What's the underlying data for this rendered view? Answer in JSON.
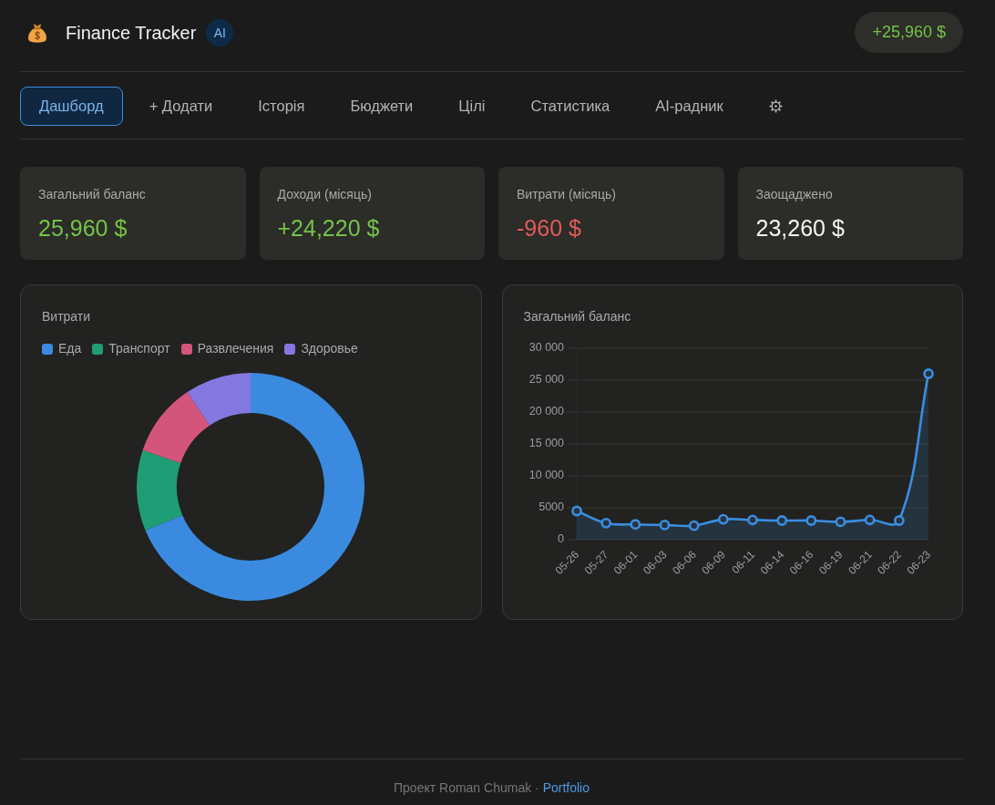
{
  "header": {
    "title": "Finance Tracker",
    "badge": "AI",
    "balance": "+25,960 $"
  },
  "nav": {
    "tabs": [
      {
        "kind": "text",
        "label": "Дашборд",
        "selected": true
      },
      {
        "kind": "text",
        "label": "+ Додати",
        "selected": false
      },
      {
        "kind": "text",
        "label": "Історія",
        "selected": false
      },
      {
        "kind": "text",
        "label": "Бюджети",
        "selected": false
      },
      {
        "kind": "text",
        "label": "Цілі",
        "selected": false
      },
      {
        "kind": "text",
        "label": "Статистика",
        "selected": false
      },
      {
        "kind": "text",
        "label": "AI-радник",
        "selected": false
      },
      {
        "kind": "settings",
        "selected": false
      }
    ]
  },
  "stats": [
    {
      "label": "Загальний баланс",
      "value": "25,960 $",
      "color": "#74c447"
    },
    {
      "label": "Доходи (місяць)",
      "value": "+24,220 $",
      "color": "#74c447"
    },
    {
      "label": "Витрати (місяць)",
      "value": "-960 $",
      "color": "#e05a5a"
    },
    {
      "label": "Заощаджено",
      "value": "23,260 $",
      "color": "#f4f4f4"
    }
  ],
  "expenses_chart": {
    "title": "Витрати",
    "legend": [
      {
        "label": "Еда",
        "color": "#3a8be0"
      },
      {
        "label": "Транспорт",
        "color": "#1f9e75"
      },
      {
        "label": "Развлечения",
        "color": "#d4557c"
      },
      {
        "label": "Здоровье",
        "color": "#8478e0"
      }
    ]
  },
  "balance_chart": {
    "chart_data": {
      "type": "area",
      "title": "Загальний баланс",
      "categories": [
        "05-26",
        "05-27",
        "06-01",
        "06-03",
        "06-06",
        "06-09",
        "06-11",
        "06-14",
        "06-16",
        "06-19",
        "06-21",
        "06-22",
        "06-23"
      ],
      "values": [
        4500,
        2600,
        2400,
        2300,
        2200,
        3200,
        3100,
        3000,
        3000,
        2800,
        3100,
        3000,
        26000
      ],
      "ylim": [
        0,
        30000
      ],
      "yticks": [
        0,
        5000,
        {
          "value": 10000,
          "label": "10 000"
        },
        {
          "value": 15000,
          "label": "15 000"
        },
        {
          "value": 20000,
          "label": "20 000"
        },
        {
          "value": 25000,
          "label": "25 000"
        },
        {
          "value": 30000,
          "label": "30 000"
        }
      ],
      "grid": true
    }
  },
  "footer": {
    "text": "Проект Roman Chumak ·",
    "link": "Portfolio"
  }
}
